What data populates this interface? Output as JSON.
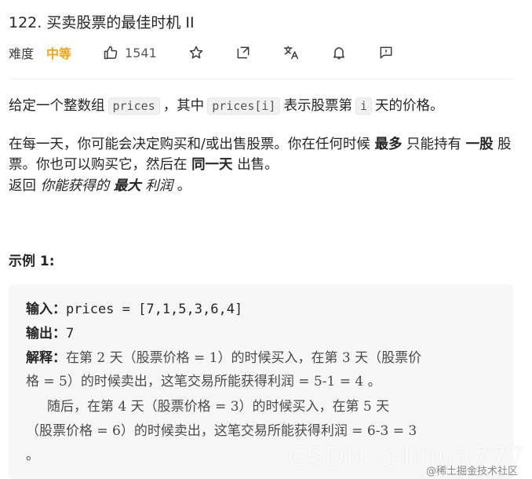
{
  "problem": {
    "title": "122. 买卖股票的最佳时机 II",
    "difficulty_label": "难度",
    "difficulty": "中等",
    "likes": "1541"
  },
  "colors": {
    "difficulty": "#ffa116",
    "code_bg": "#f2f2f3",
    "example_bg": "#f7f7f8"
  },
  "icons": [
    "thumbs-up-icon",
    "star-icon",
    "share-icon",
    "translate-icon",
    "bell-icon",
    "feedback-icon"
  ],
  "description": {
    "p1": {
      "t1": "给定一个整数组",
      "c1": "prices",
      "t2": "，其中",
      "c2": "prices[i]",
      "t3": "表示股票第",
      "c3": "i",
      "t4": "天的价格。"
    },
    "p2": {
      "t1": "在每一天，你可能会决定购买和/或出售股票。你在任何时候 ",
      "b1": "最多",
      "t2": " 只能持有 ",
      "b2": "一股",
      "t3": " 股票。你也可以购买它，然后在 ",
      "b3": "同一天",
      "t4": " 出售。"
    },
    "p3": {
      "t1": "返回 ",
      "i1": "你能获得的",
      "b1": "最大",
      "i2": "利润",
      "t2": " 。"
    }
  },
  "example": {
    "heading": "示例 1:",
    "input_label": "输入：",
    "input_value": "prices = [7,1,5,3,6,4]",
    "output_label": "输出：",
    "output_value": "7",
    "explain_label": "解释：",
    "explain_line1": "在第 2 天（股票价格 = 1）的时候买入，在第 3 天（股票价",
    "explain_line2": "格 = 5）的时候卖出，这笔交易所能获得利润 = 5-1 = 4 。",
    "explain_line3": "     随后，在第 4 天（股票价格 = 3）的时候买入，在第 5 天",
    "explain_line4": "（股票价格 = 6）的时候卖出，这笔交易所能获得利润 = 6-3 = 3",
    "explain_line5": "。"
  },
  "watermark": {
    "main": "CSDN @lihua777",
    "sub": "@稀土掘金技术社区"
  }
}
